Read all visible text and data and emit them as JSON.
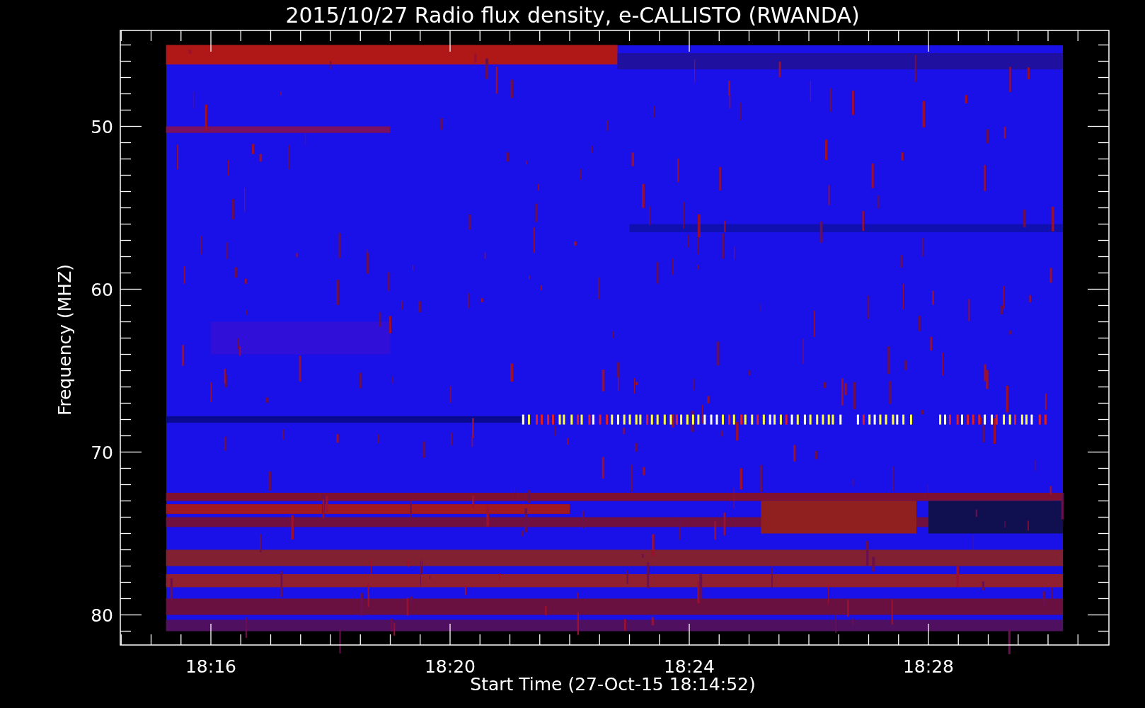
{
  "title": "2015/10/27  Radio flux density, e-CALLISTO (RWANDA)",
  "y_axis": {
    "label": "Frequency (MHZ)",
    "ticks": [
      "50",
      "60",
      "70",
      "80"
    ]
  },
  "x_axis": {
    "label": "Start Time (27-Oct-15 18:14:52)",
    "ticks": [
      "18:16",
      "18:20",
      "18:24",
      "18:28"
    ]
  }
}
